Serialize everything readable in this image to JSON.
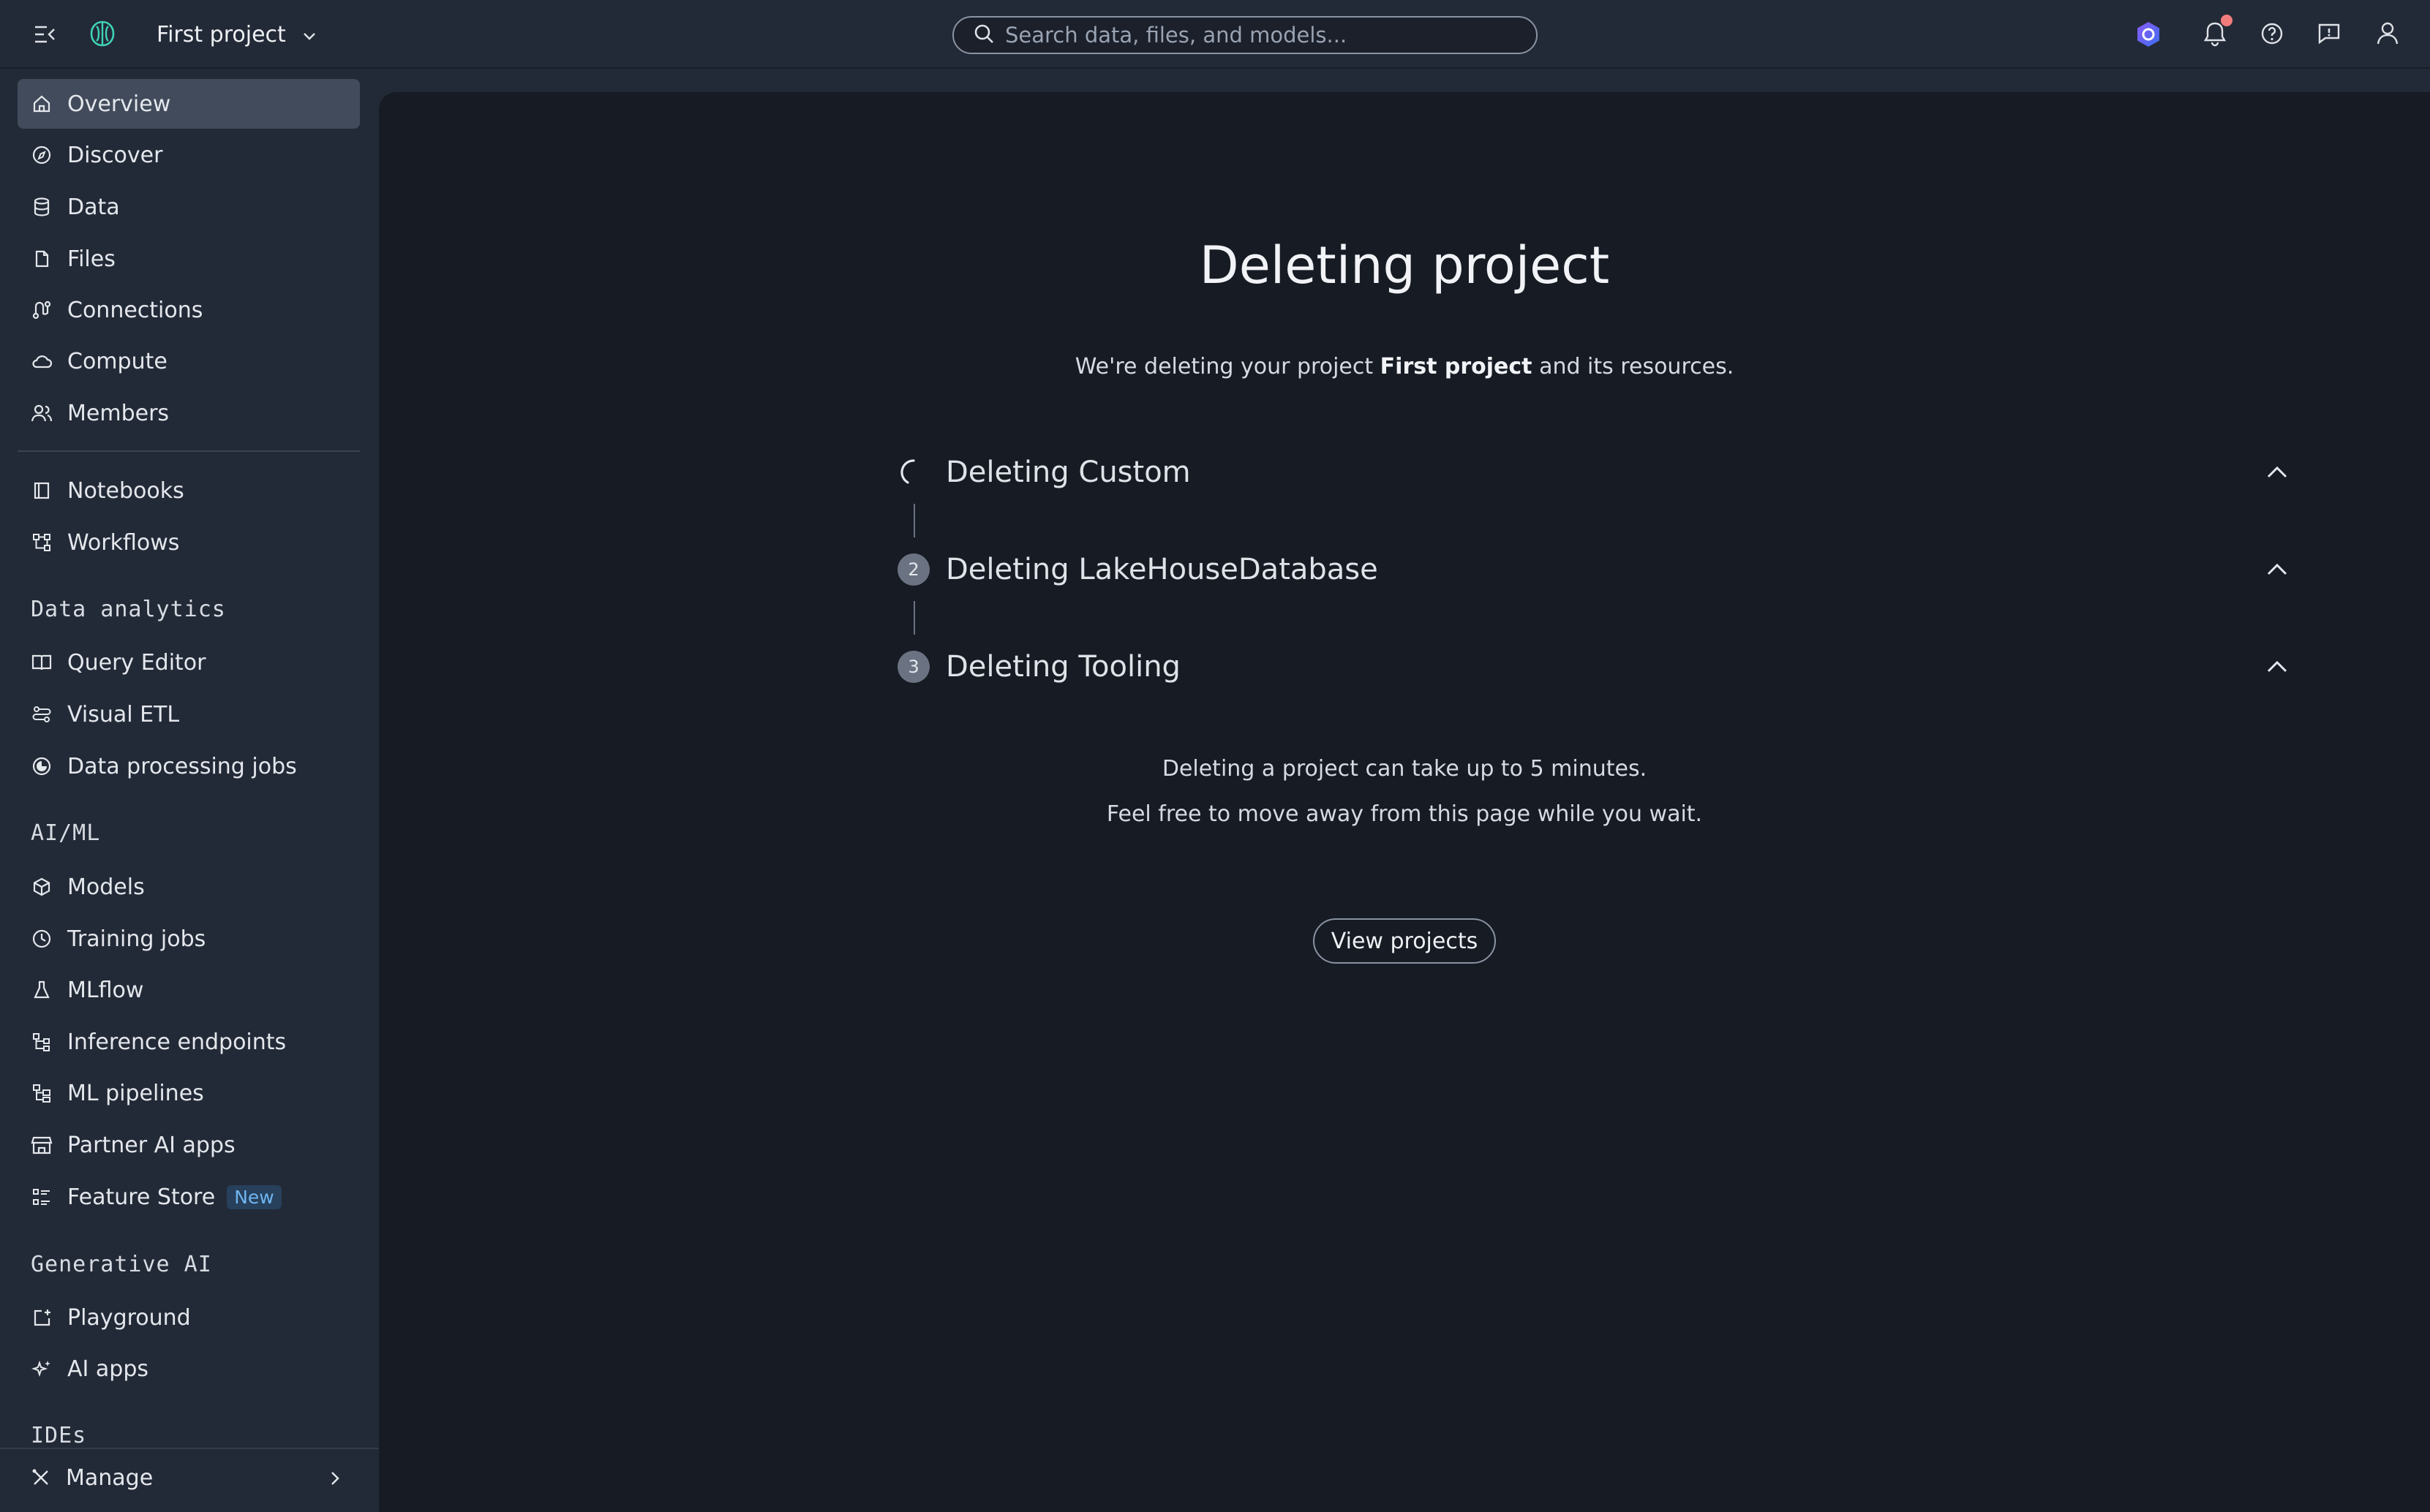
{
  "header": {
    "project_name": "First project",
    "search_placeholder": "Search data, files, and models..."
  },
  "sidebar": {
    "items_top": [
      {
        "label": "Overview",
        "icon": "home-icon"
      },
      {
        "label": "Discover",
        "icon": "compass-icon"
      },
      {
        "label": "Data",
        "icon": "database-icon"
      },
      {
        "label": "Files",
        "icon": "file-icon"
      },
      {
        "label": "Connections",
        "icon": "connections-icon"
      },
      {
        "label": "Compute",
        "icon": "cloud-icon"
      },
      {
        "label": "Members",
        "icon": "members-icon"
      }
    ],
    "items_tools": [
      {
        "label": "Notebooks",
        "icon": "notebook-icon"
      },
      {
        "label": "Workflows",
        "icon": "workflow-icon"
      }
    ],
    "section_data_analytics": "Data analytics",
    "items_data_analytics": [
      {
        "label": "Query Editor",
        "icon": "book-icon"
      },
      {
        "label": "Visual ETL",
        "icon": "etl-icon"
      },
      {
        "label": "Data processing jobs",
        "icon": "jobs-icon"
      }
    ],
    "section_aiml": "AI/ML",
    "items_aiml": [
      {
        "label": "Models",
        "icon": "cube-icon"
      },
      {
        "label": "Training jobs",
        "icon": "clock-icon"
      },
      {
        "label": "MLflow",
        "icon": "flask-icon"
      },
      {
        "label": "Inference endpoints",
        "icon": "endpoints-icon"
      },
      {
        "label": "ML pipelines",
        "icon": "pipeline-icon"
      },
      {
        "label": "Partner AI apps",
        "icon": "store-icon"
      },
      {
        "label": "Feature Store",
        "icon": "feature-store-icon",
        "badge": "New"
      }
    ],
    "section_genai": "Generative AI",
    "items_genai": [
      {
        "label": "Playground",
        "icon": "playground-icon"
      },
      {
        "label": "AI apps",
        "icon": "sparkle-icon"
      }
    ],
    "section_ides": "IDEs",
    "manage_label": "Manage"
  },
  "main": {
    "title": "Deleting project",
    "subtitle_prefix": "We're deleting your project ",
    "subtitle_project": "First project",
    "subtitle_suffix": " and its resources.",
    "steps": [
      {
        "number": "",
        "label": "Deleting Custom",
        "status": "in-progress"
      },
      {
        "number": "2",
        "label": "Deleting LakeHouseDatabase",
        "status": "pending"
      },
      {
        "number": "3",
        "label": "Deleting Tooling",
        "status": "pending"
      }
    ],
    "note_line1": "Deleting a project can take up to 5 minutes.",
    "note_line2": "Feel free to move away from this page while you wait.",
    "view_projects_label": "View projects"
  },
  "colors": {
    "sidebar_bg": "#232a37",
    "main_bg": "#161b24",
    "active_item_bg": "#414b5b",
    "notification_dot": "#f27c7c",
    "new_badge_text": "#6fb5f0",
    "accent_purple": "#6b5cf0"
  }
}
